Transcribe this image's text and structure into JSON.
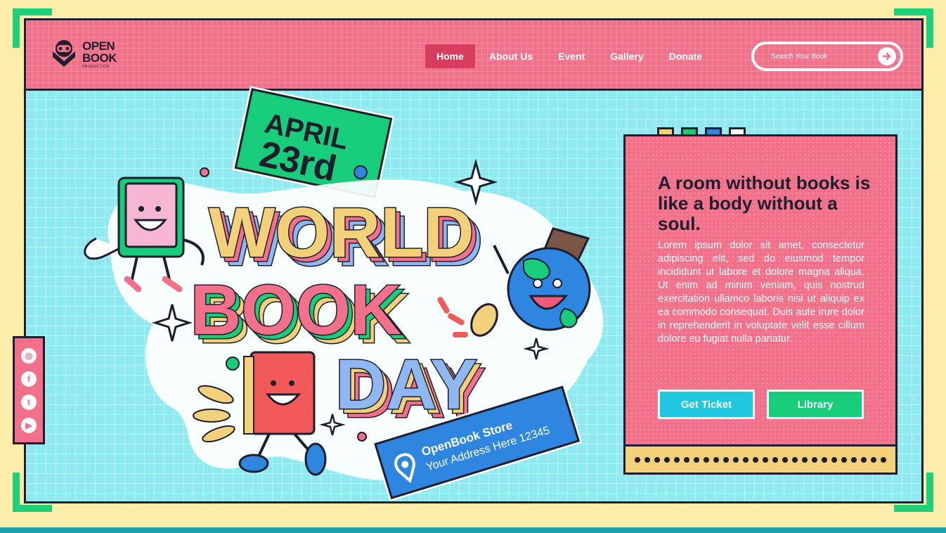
{
  "brand": {
    "line1": "OPEN",
    "line2": "BOOK",
    "sub": "PRODUCTION"
  },
  "nav": {
    "items": [
      {
        "label": "Home",
        "active": true
      },
      {
        "label": "About Us",
        "active": false
      },
      {
        "label": "Event",
        "active": false
      },
      {
        "label": "Gallery",
        "active": false
      },
      {
        "label": "Donate",
        "active": false
      }
    ]
  },
  "search": {
    "placeholder": "Search Your Book",
    "button_icon": "arrow-right-icon"
  },
  "social": [
    {
      "icon": "instagram-icon",
      "glyph": "◎"
    },
    {
      "icon": "facebook-icon",
      "glyph": "f"
    },
    {
      "icon": "twitter-icon",
      "glyph": "t"
    },
    {
      "icon": "youtube-icon",
      "glyph": "▶"
    }
  ],
  "hero": {
    "date_line1": "APRIL",
    "date_line2": "23rd",
    "title_line1": "WORLD",
    "title_line2": "BOOK",
    "title_line3": "DAY",
    "store_name": "OpenBook Store",
    "store_address": "Your Address Here 12345"
  },
  "card": {
    "dot_colors": [
      "#f2d17a",
      "#17cc7a",
      "#2f86e0",
      "#ffffff"
    ],
    "title": "A room without books is like a body without a soul.",
    "body": "Lorem ipsum dolor sit amet, consectetur adipiscing elit, sed do eiusmod tempor incididunt ut labore et dolore magna aliqua. Ut enim ad minim veniam, quis nostrud exercitation ullamco laboris nisi ut aliquip ex ea commodo consequat. Duis aute irure dolor in reprehenderit in voluptate velit esse cillum dolore eu fugiat nulla pariatur.",
    "primary_button": "Get Ticket",
    "secondary_button": "Library"
  },
  "colors": {
    "pink": "#f2708a",
    "cyan": "#8eeaf0",
    "green": "#17cc7a",
    "yellow": "#f2d17a",
    "blue": "#2f86e0",
    "dark": "#1e1e2e"
  }
}
